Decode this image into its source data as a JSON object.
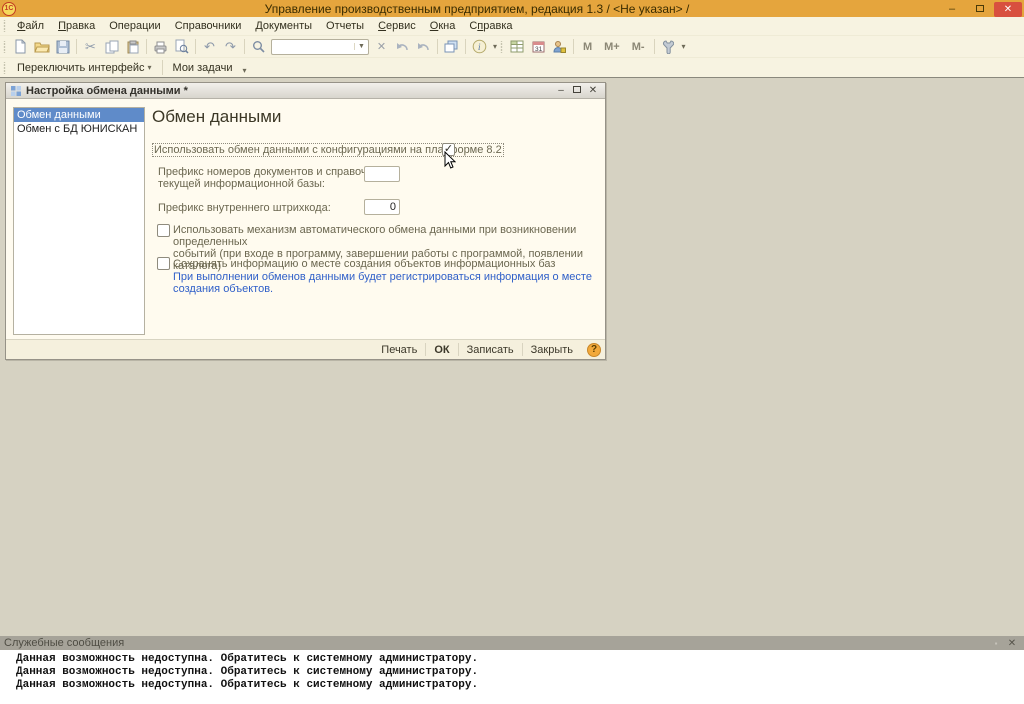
{
  "app": {
    "logo": "1С",
    "title": "Управление производственным предприятием, редакция 1.3 / <Не указан> /"
  },
  "icons": {
    "minimize": "–",
    "close": "✕",
    "check": "✓",
    "cut": "✂",
    "undo": "↶",
    "redo": "↷",
    "combo_arrow": "▼",
    "caret": "▾",
    "clear_x": "✕",
    "pin": "▪",
    "dialog_minimize": "–"
  },
  "menu": {
    "items": [
      {
        "pre": "",
        "u": "Ф",
        "rest": "айл"
      },
      {
        "pre": "",
        "u": "П",
        "rest": "равка"
      },
      {
        "pre": "Операции",
        "u": "",
        "rest": ""
      },
      {
        "pre": "Справочники",
        "u": "",
        "rest": ""
      },
      {
        "pre": "Документы",
        "u": "",
        "rest": ""
      },
      {
        "pre": "Отчеты",
        "u": "",
        "rest": ""
      },
      {
        "pre": "",
        "u": "С",
        "rest": "ервис"
      },
      {
        "pre": "",
        "u": "О",
        "rest": "кна"
      },
      {
        "pre": "С",
        "u": "п",
        "rest": "равка"
      }
    ]
  },
  "toolbar": {
    "search_value": "",
    "memory_buttons": [
      "M",
      "M+",
      "M-"
    ]
  },
  "toolbar2": {
    "switch_interface": "Переключить интерфейс",
    "my_tasks": "Мои задачи"
  },
  "dialog": {
    "title": "Настройка обмена данными *",
    "sidebar_items": [
      "Обмен данными",
      "Обмен с БД ЮНИСКАН"
    ],
    "heading": "Обмен данными",
    "checkbox_platform": {
      "label": "Использовать обмен данными с конфигурациями на платформе 8.2",
      "checked": true
    },
    "prefix_docs": {
      "label_line1": "Префикс номеров документов и справочников",
      "label_line2": "текущей информационной базы:",
      "value": ""
    },
    "prefix_barcode": {
      "label": "Префикс внутреннего штрихкода:",
      "value": "0"
    },
    "checkbox_auto": {
      "label_line1": "Использовать механизм автоматического обмена данными при возникновении определенных",
      "label_line2": "событий (при входе в программу, завершении работы с программой, появлении каталога)",
      "checked": false
    },
    "checkbox_save_info": {
      "label": "Сохранять информацию о месте создания объектов информационных баз",
      "checked": false
    },
    "hint": "При выполнении обменов данными будет регистрироваться информация о месте создания объектов.",
    "buttons": [
      "Печать",
      "ОК",
      "Записать",
      "Закрыть"
    ],
    "help": "?"
  },
  "svc": {
    "title": "Служебные сообщения",
    "messages": [
      "Данная возможность недоступна. Обратитесь к системному администратору.",
      "Данная возможность недоступна. Обратитесь к системному администратору.",
      "Данная возможность недоступна. Обратитесь к системному администратору."
    ]
  },
  "colors": {
    "titlebar": "#e5a53d",
    "close_button": "#d8503f",
    "selection": "#5f8bc9",
    "hint_text": "#2f5fc8",
    "mdi_background": "#d6d2c2",
    "dialog_background": "#fffbef"
  }
}
